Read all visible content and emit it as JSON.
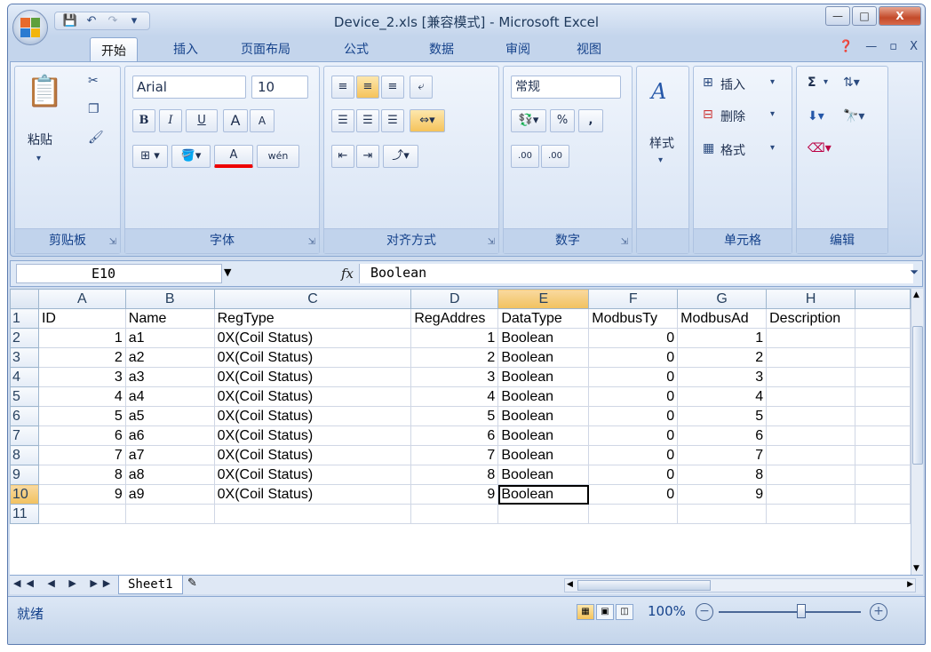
{
  "window": {
    "title": "Device_2.xls  [兼容模式] - Microsoft Excel"
  },
  "qat": {
    "save": "💾",
    "undo": "↶",
    "redo": "↷",
    "customize": "▾"
  },
  "tabs": [
    "开始",
    "插入",
    "页面布局",
    "公式",
    "数据",
    "审阅",
    "视图"
  ],
  "ribbon": {
    "clipboard": {
      "label": "剪贴板",
      "paste": "粘贴"
    },
    "font": {
      "label": "字体",
      "name": "Arial",
      "size": "10",
      "bold": "B",
      "italic": "I",
      "underline": "U",
      "grow": "A",
      "shrink": "A",
      "color_letter": "A",
      "phonetic": "wén"
    },
    "align": {
      "label": "对齐方式"
    },
    "number": {
      "label": "数字",
      "format": "常规",
      "percent": "%",
      "comma": ",",
      "inc_dec": ".00",
      "dec_dec": ".00"
    },
    "styles": {
      "label": "样式"
    },
    "cells": {
      "label": "单元格",
      "insert": "插入",
      "delete": "删除",
      "format": "格式"
    },
    "editing": {
      "label": "编辑",
      "sum": "Σ"
    }
  },
  "formula_bar": {
    "name_box": "E10",
    "fx": "fx",
    "value": "Boolean"
  },
  "sheet": {
    "columns": [
      "A",
      "B",
      "C",
      "D",
      "E",
      "F",
      "G",
      "H"
    ],
    "header_row": [
      "ID",
      "Name",
      "RegType",
      "RegAddres",
      "DataType",
      "ModbusTy",
      "ModbusAd",
      "Description"
    ],
    "rows": [
      [
        "1",
        "a1",
        "0X(Coil Status)",
        "1",
        "Boolean",
        "0",
        "1",
        ""
      ],
      [
        "2",
        "a2",
        "0X(Coil Status)",
        "2",
        "Boolean",
        "0",
        "2",
        ""
      ],
      [
        "3",
        "a3",
        "0X(Coil Status)",
        "3",
        "Boolean",
        "0",
        "3",
        ""
      ],
      [
        "4",
        "a4",
        "0X(Coil Status)",
        "4",
        "Boolean",
        "0",
        "4",
        ""
      ],
      [
        "5",
        "a5",
        "0X(Coil Status)",
        "5",
        "Boolean",
        "0",
        "5",
        ""
      ],
      [
        "6",
        "a6",
        "0X(Coil Status)",
        "6",
        "Boolean",
        "0",
        "6",
        ""
      ],
      [
        "7",
        "a7",
        "0X(Coil Status)",
        "7",
        "Boolean",
        "0",
        "7",
        ""
      ],
      [
        "8",
        "a8",
        "0X(Coil Status)",
        "8",
        "Boolean",
        "0",
        "8",
        ""
      ],
      [
        "9",
        "a9",
        "0X(Coil Status)",
        "9",
        "Boolean",
        "0",
        "9",
        ""
      ]
    ],
    "row_numbers": [
      "1",
      "2",
      "3",
      "4",
      "5",
      "6",
      "7",
      "8",
      "9",
      "10",
      "11"
    ],
    "selected_cell": "E10",
    "selected_column": "E",
    "selected_row": "10"
  },
  "sheet_tabs": {
    "nav": "◀◀ ◀ ▶ ▶▶",
    "active": "Sheet1"
  },
  "status": {
    "ready": "就绪",
    "zoom": "100%",
    "minus": "−",
    "plus": "+"
  }
}
